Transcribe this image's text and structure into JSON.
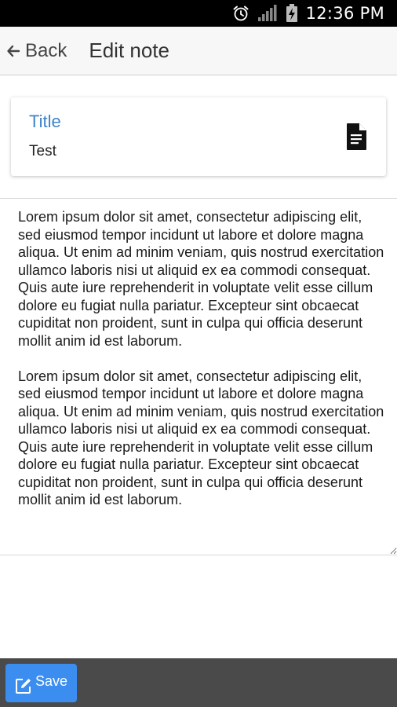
{
  "status_bar": {
    "time": "12:36 PM",
    "icons": [
      "alarm-icon",
      "signal-icon",
      "battery-charging-icon"
    ]
  },
  "header": {
    "back_label": "Back",
    "title": "Edit note"
  },
  "card": {
    "label": "Title",
    "value": "Test",
    "icon": "document-icon"
  },
  "note": {
    "body": "Lorem ipsum dolor sit amet, consectetur adipiscing elit, sed eiusmod tempor incidunt ut labore et dolore magna aliqua. Ut enim ad minim veniam, quis nostrud exercitation ullamco laboris nisi ut aliquid ex ea commodi consequat. Quis aute iure reprehenderit in voluptate velit esse cillum dolore eu fugiat nulla pariatur. Excepteur sint obcaecat cupiditat non proident, sunt in culpa qui officia deserunt mollit anim id est laborum.\n\nLorem ipsum dolor sit amet, consectetur adipiscing elit, sed eiusmod tempor incidunt ut labore et dolore magna aliqua. Ut enim ad minim veniam, quis nostrud exercitation ullamco laboris nisi ut aliquid ex ea commodi consequat. Quis aute iure reprehenderit in voluptate velit esse cillum dolore eu fugiat nulla pariatur. Excepteur sint obcaecat cupiditat non proident, sunt in culpa qui officia deserunt mollit anim id est laborum."
  },
  "footer": {
    "save_label": "Save",
    "save_icon": "edit-icon"
  },
  "colors": {
    "accent": "#3f83c8",
    "save_button": "#3b8ef0",
    "footer_bg": "#4a4a4a",
    "header_bg": "#f7f7f7"
  }
}
